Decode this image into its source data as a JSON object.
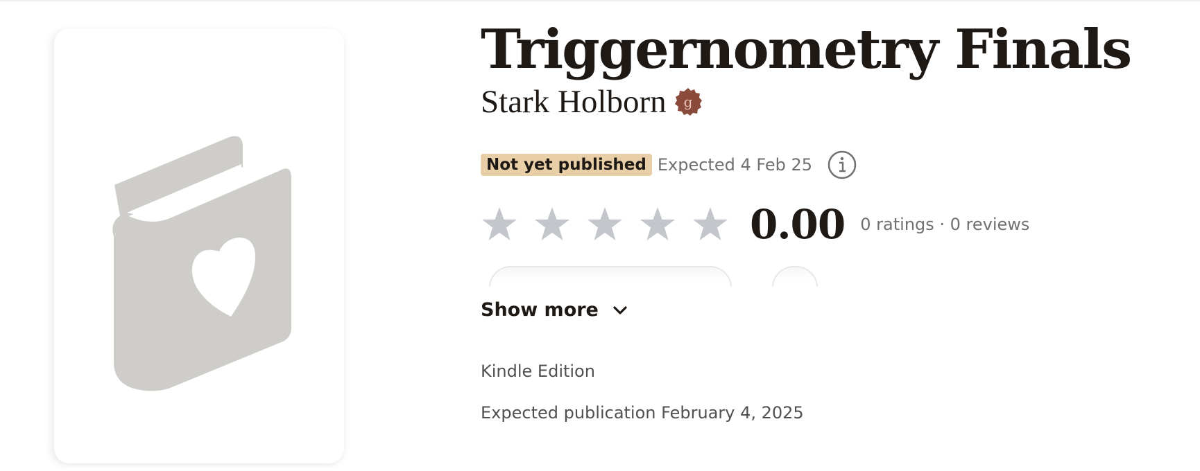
{
  "book": {
    "title": "Triggernometry Finals",
    "author": "Stark Holborn",
    "author_badge_icon": "goodreads-author-badge",
    "cover_icon": "book-with-heart-placeholder"
  },
  "publication": {
    "status_badge": "Not yet published",
    "expected_short": "Expected 4 Feb 25",
    "info_icon": "info-circle-icon"
  },
  "rating": {
    "stars_filled": 0,
    "stars_total": 5,
    "average": "0.00",
    "counts": "0 ratings · 0 reviews"
  },
  "show_more": {
    "label": "Show more",
    "icon": "chevron-down-icon"
  },
  "details": {
    "format": "Kindle Edition",
    "expected_publication": "Expected publication February 4, 2025"
  },
  "colors": {
    "badge_bg": "#e9cfa7",
    "star_empty": "#c3c7cb",
    "placeholder_gray": "#cecdca",
    "author_badge": "#8a4a3c"
  }
}
